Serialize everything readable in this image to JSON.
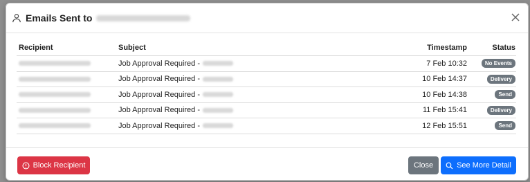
{
  "modal": {
    "title": "Emails Sent to",
    "icons": {
      "title": "person-icon",
      "close": "close-icon"
    }
  },
  "table": {
    "headers": {
      "recipient": "Recipient",
      "subject": "Subject",
      "timestamp": "Timestamp",
      "status": "Status"
    },
    "rows": [
      {
        "subject": "Job Approval Required -",
        "timestamp": "7 Feb 10:32",
        "status": "No Events"
      },
      {
        "subject": "Job Approval Required -",
        "timestamp": "10 Feb 14:37",
        "status": "Delivery"
      },
      {
        "subject": "Job Approval Required -",
        "timestamp": "10 Feb 14:38",
        "status": "Send"
      },
      {
        "subject": "Job Approval Required -",
        "timestamp": "11 Feb 15:41",
        "status": "Delivery"
      },
      {
        "subject": "Job Approval Required -",
        "timestamp": "12 Feb 15:51",
        "status": "Send"
      }
    ]
  },
  "footer": {
    "block_label": "Block Recipient",
    "close_label": "Close",
    "more_label": "See More Detail"
  },
  "colors": {
    "danger": "#dc3545",
    "secondary": "#6c757d",
    "primary": "#0d6efd"
  }
}
